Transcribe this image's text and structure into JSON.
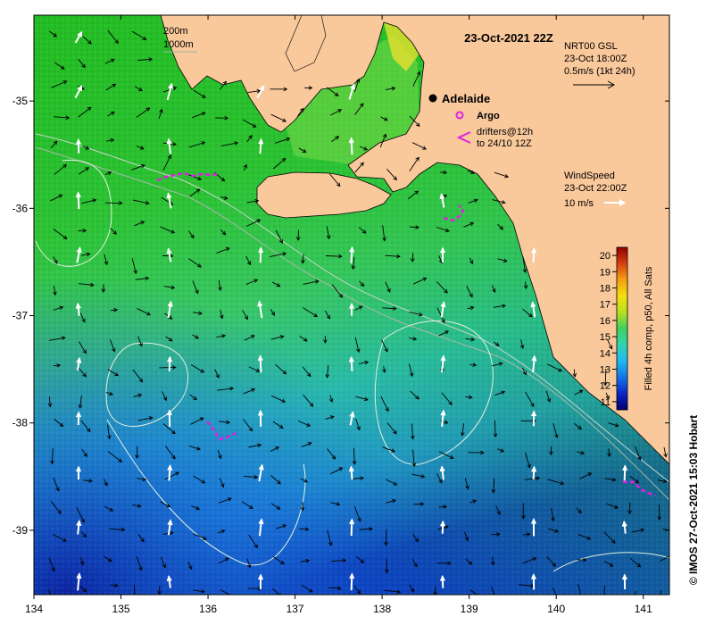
{
  "map": {
    "title": "23-Oct-2021 22Z",
    "lon_ticks": [
      "134",
      "135",
      "136",
      "137",
      "138",
      "139",
      "140",
      "141"
    ],
    "lat_ticks": [
      "-35",
      "-36",
      "-37",
      "-38",
      "-39"
    ],
    "lon_range": [
      134,
      141.3
    ],
    "lat_range": [
      -39.6,
      -34.2
    ],
    "contours": {
      "depth_1": "200m",
      "depth_2": "1000m"
    },
    "city": {
      "name": "Adelaide",
      "lon": 138.6,
      "lat": -34.93
    },
    "legend": {
      "argo": "Argo",
      "drifters_line1": "drifters@12h",
      "drifters_line2": "to 24/10 12Z"
    },
    "currents": {
      "line1": "NRT00 GSL",
      "line2": "23-Oct 18:00Z",
      "line3": "0.5m/s (1kt 24h)"
    },
    "wind": {
      "line1": "WindSpeed",
      "line2": "23-Oct 22:00Z",
      "line3": "10 m/s"
    },
    "colorbar": {
      "title": "Filled 4h comp, p50, All Sats",
      "ticks": [
        "20",
        "19",
        "18",
        "17",
        "16",
        "15",
        "14",
        "13",
        "12",
        "11"
      ],
      "range": [
        10.5,
        20.5
      ]
    },
    "credit": "© IMOS 27-Oct-2021 15:03 Hobart",
    "colors": {
      "land": "#f9c89b",
      "sst_cool": "#0a2fb0",
      "sst_mid": "#27b0e8",
      "sst_warm": "#2ec82a",
      "drifter": "#e020e0"
    },
    "icons": [
      "current-arrow-icon",
      "wind-arrow-icon",
      "argo-float-icon",
      "drifter-track-icon",
      "city-marker-icon"
    ]
  }
}
